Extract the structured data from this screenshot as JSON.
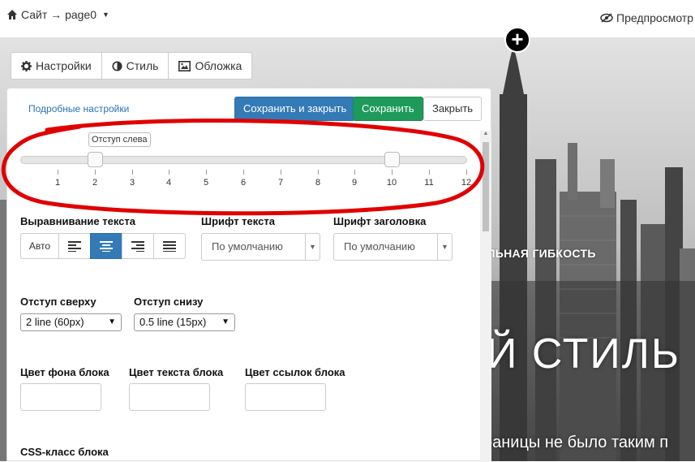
{
  "topbar": {
    "site_nav": "Сайт → page0",
    "preview": "Предпросмотр"
  },
  "tabs": [
    {
      "label": "Настройки",
      "icon": "gear-icon"
    },
    {
      "label": "Стиль",
      "icon": "contrast-icon"
    },
    {
      "label": "Обложка",
      "icon": "image-icon"
    }
  ],
  "panel": {
    "advanced_link": "Подробные настройки",
    "save_close": "Сохранить и закрыть",
    "save": "Сохранить",
    "close": "Закрыть"
  },
  "slider": {
    "tooltip": "Отступ слева",
    "ticks": [
      "1",
      "2",
      "3",
      "4",
      "5",
      "6",
      "7",
      "8",
      "9",
      "10",
      "11",
      "12"
    ],
    "handle_values": [
      2,
      10
    ]
  },
  "form": {
    "text_align_label": "Выравнивание текста",
    "auto_label": "Авто",
    "align_active": "center",
    "text_font_label": "Шрифт текста",
    "text_font_value": "По умолчанию",
    "heading_font_label": "Шрифт заголовка",
    "heading_font_value": "По умолчанию",
    "padding_top_label": "Отступ сверху",
    "padding_top_value": "2 line (60px)",
    "padding_bottom_label": "Отступ снизу",
    "padding_bottom_value": "0.5 line (15px)",
    "bg_color_label": "Цвет фона блока",
    "text_color_label": "Цвет текста блока",
    "link_color_label": "Цвет ссылок блока",
    "css_class_label": "CSS-класс блока"
  },
  "hero": {
    "line1": "АЛЬНАЯ ГИБКОСТЬ",
    "line2": "Й СТИЛЬ",
    "line3": "раницы не было таким п"
  },
  "colors": {
    "primary": "#337ab7",
    "success": "#1e9a5b",
    "annotation": "#e00000"
  }
}
